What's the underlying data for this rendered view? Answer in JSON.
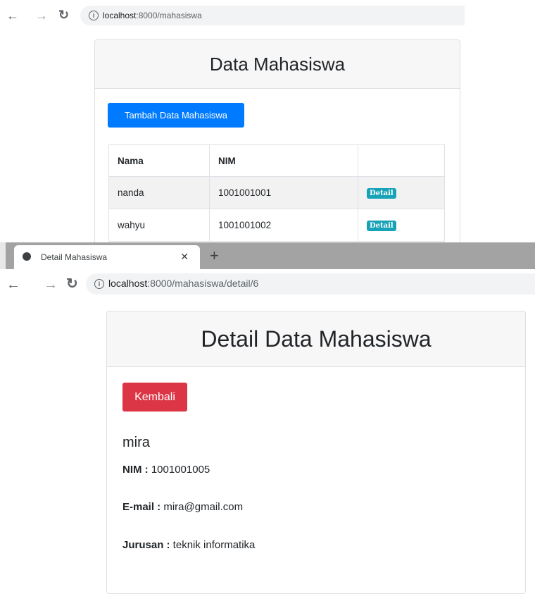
{
  "top": {
    "url_host": "localhost",
    "url_path": ":8000/mahasiswa",
    "title": "Data Mahasiswa",
    "add_button": "Tambah Data Mahasiswa",
    "table": {
      "headers": [
        "Nama",
        "NIM",
        ""
      ],
      "rows": [
        {
          "nama": "nanda",
          "nim": "1001001001",
          "action": "Detail"
        },
        {
          "nama": "wahyu",
          "nim": "1001001002",
          "action": "Detail"
        }
      ]
    }
  },
  "bottom": {
    "tab_title": "Detail Mahasiswa",
    "url_host": "localhost",
    "url_path": ":8000/mahasiswa/detail/6",
    "title": "Detail Data Mahasiswa",
    "back_button": "Kembali",
    "name": "mira",
    "fields": [
      {
        "label": "NIM :",
        "value": " 1001001005"
      },
      {
        "label": "E-mail :",
        "value": " mira@gmail.com"
      },
      {
        "label": "Jurusan :",
        "value": " teknik informatika"
      }
    ]
  },
  "colors": {
    "primary": "#007bff",
    "danger": "#dc3545",
    "info": "#17a2b8"
  }
}
